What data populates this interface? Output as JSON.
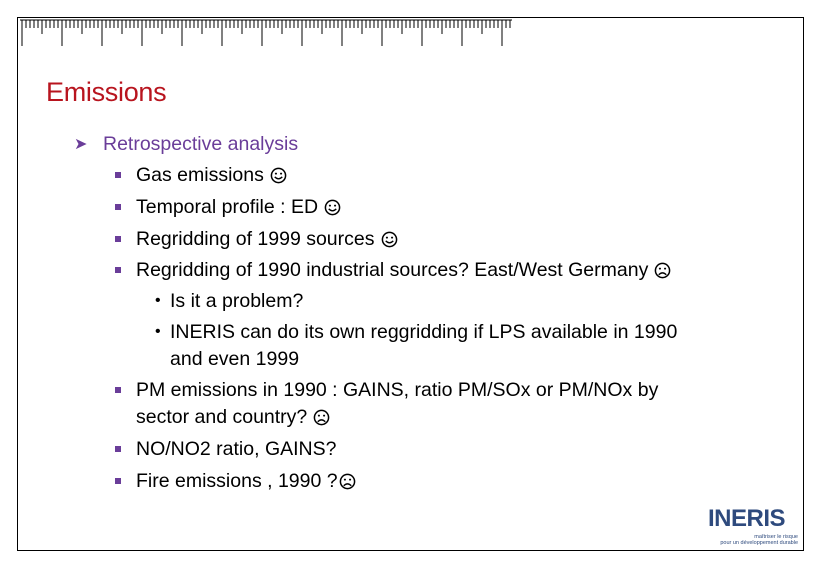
{
  "slide": {
    "title": "Emissions",
    "heading": "Retrospective analysis",
    "items": [
      {
        "text": "Gas emissions",
        "mood": "happy"
      },
      {
        "text": "Temporal profile : ED",
        "mood": "happy"
      },
      {
        "text": "Regridding of 1999 sources",
        "mood": "happy"
      },
      {
        "text": "Regridding of 1990 industrial sources? East/West Germany",
        "mood": "sad"
      }
    ],
    "subitems": [
      {
        "text": "Is it a problem?"
      },
      {
        "text": "INERIS can do its own reggridding if  LPS  available in 1990",
        "text2": "and even 1999"
      }
    ],
    "items_after": [
      {
        "text": "PM emissions in 1990 : GAINS, ratio PM/SOx or PM/NOx by",
        "text2": "sector and country?",
        "mood": "sad"
      },
      {
        "text": "NO/NO2 ratio, GAINS?"
      },
      {
        "text": "Fire emissions , 1990 ?",
        "mood": "sad"
      }
    ]
  },
  "logo": {
    "name": "INERIS",
    "tagline_1": "maîtriser le risque",
    "tagline_2": "pour un développement durable"
  },
  "colors": {
    "title": "#b8141e",
    "bullet": "#6a3d99",
    "logo": "#2e4a7d"
  }
}
